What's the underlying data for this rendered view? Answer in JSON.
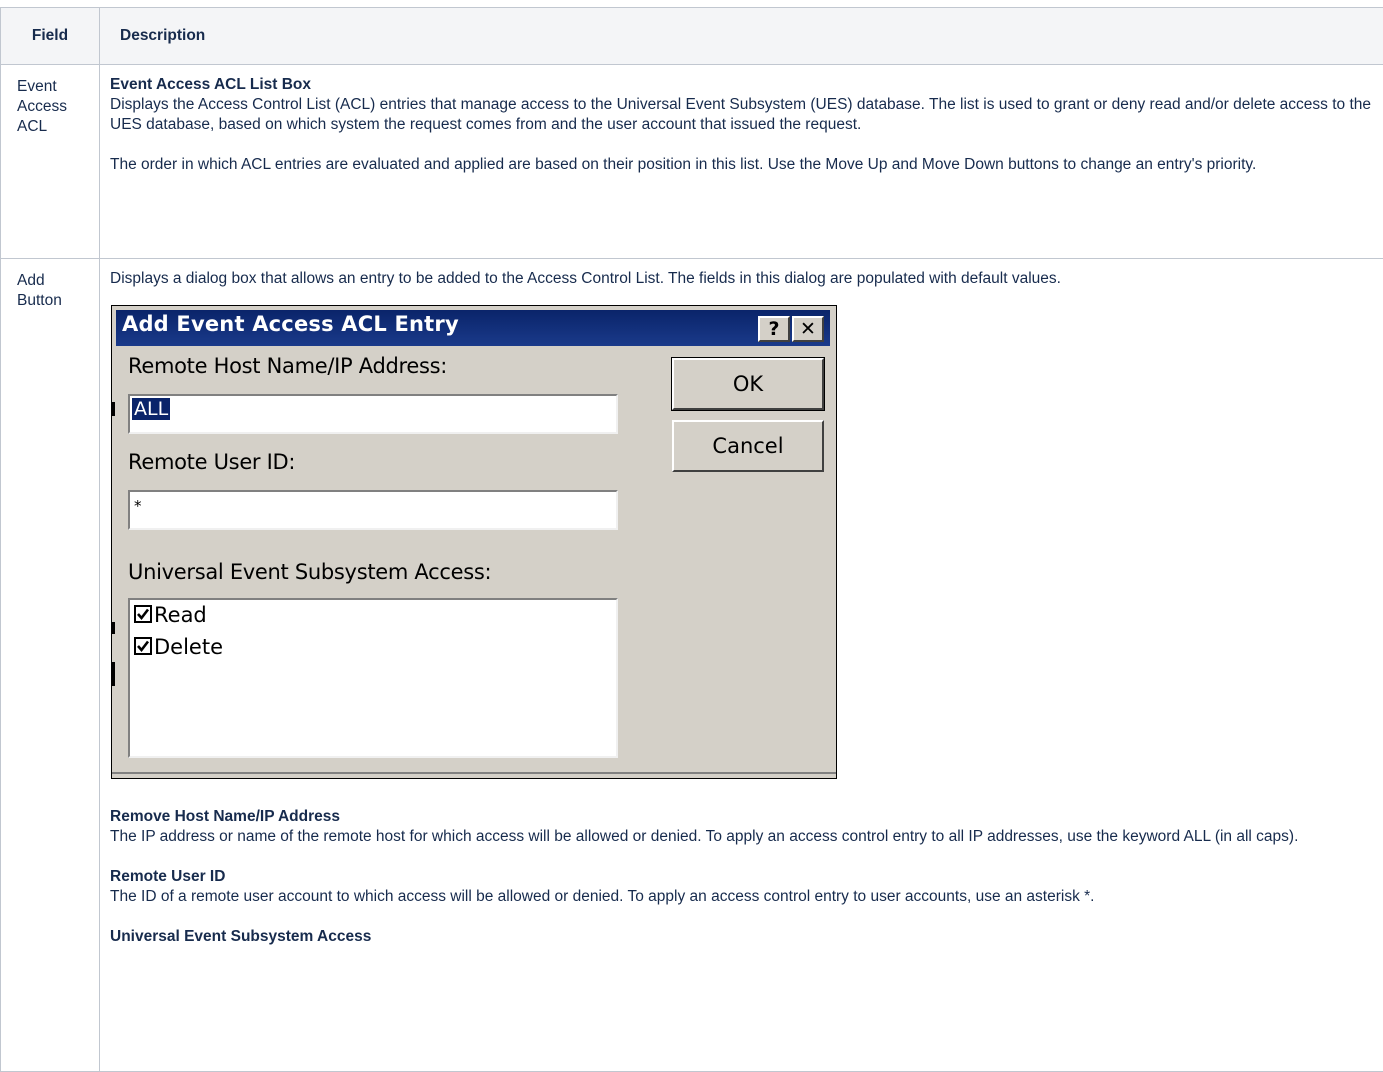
{
  "table": {
    "headers": [
      "Field",
      "Description"
    ],
    "rows": [
      {
        "field": "Event Access ACL",
        "title": "Event Access ACL List Box",
        "p1": "Displays the Access Control List (ACL) entries that manage access to the Universal Event Subsystem (UES) database. The list is used to grant or deny read and/or delete access to the UES database, based on which system the request comes from and the user account that issued the request.",
        "p2": "The order in which ACL entries are evaluated and applied are based on their position in this list. Use the Move Up and Move Down buttons to change an entry's priority."
      },
      {
        "field": "Add Button",
        "intro": "Displays a dialog box that allows an entry to be added to the Access Control List. The fields in this dialog are populated with default values.",
        "sections": [
          {
            "title": "Remove Host Name/IP Address",
            "text": "The IP address or name of the remote host for which access will be allowed or denied. To apply an access control entry to all IP addresses, use the keyword ALL (in all caps)."
          },
          {
            "title": "Remote User ID",
            "text": "The ID of a remote user account to which access will be allowed or denied. To apply an access control entry to user accounts, use an asterisk *."
          },
          {
            "title": "Universal Event Subsystem Access",
            "text": ""
          }
        ]
      }
    ]
  },
  "dialog": {
    "title": "Add Event Access ACL Entry",
    "help_label": "?",
    "close_label": "✕",
    "host_label": "Remote Host Name/IP Address:",
    "host_value": "ALL",
    "user_label": "Remote User ID:",
    "user_value": "*",
    "access_label": "Universal Event Subsystem Access:",
    "access_items": [
      {
        "label": "Read",
        "checked": true
      },
      {
        "label": "Delete",
        "checked": true
      }
    ],
    "ok_label": "OK",
    "cancel_label": "Cancel",
    "colors": {
      "titlebar": "#0a246a",
      "face": "#d4d0c8",
      "header_bg": "#f4f5f7",
      "border": "#c1c7d0"
    }
  }
}
